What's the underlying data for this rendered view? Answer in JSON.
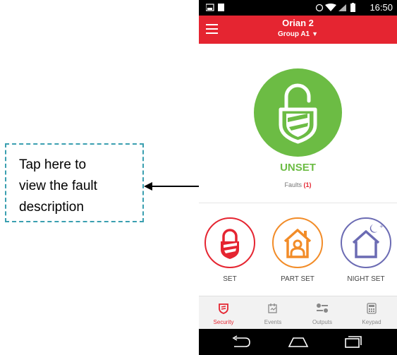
{
  "callout": {
    "line1": "Tap here to",
    "line2": "view the fault",
    "line3": "description"
  },
  "status_bar": {
    "time": "16:50"
  },
  "app_bar": {
    "title": "Orian 2",
    "group": "Group A1"
  },
  "status": {
    "state": "UNSET",
    "faults_label": "Faults",
    "faults_count": "(1)"
  },
  "modes": [
    {
      "label": "SET",
      "color": "#e52531",
      "icon": "lock-icon"
    },
    {
      "label": "PART SET",
      "color": "#f28c28",
      "icon": "house-person-icon"
    },
    {
      "label": "NIGHT SET",
      "color": "#6b6bb3",
      "icon": "house-moon-icon"
    }
  ],
  "tabs": [
    {
      "label": "Security",
      "icon": "shield-icon",
      "active": true
    },
    {
      "label": "Events",
      "icon": "events-icon",
      "active": false
    },
    {
      "label": "Outputs",
      "icon": "toggles-icon",
      "active": false
    },
    {
      "label": "Keypad",
      "icon": "keypad-icon",
      "active": false
    }
  ],
  "colors": {
    "accent": "#e52531",
    "unset_green": "#6cbc44",
    "callout_border": "#3a9fb0"
  }
}
